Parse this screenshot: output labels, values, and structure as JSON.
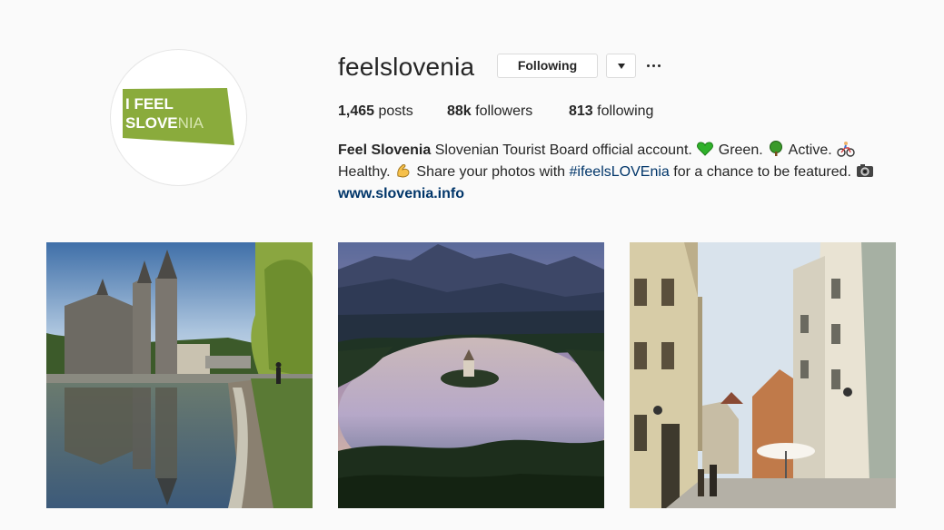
{
  "profile": {
    "username": "feelslovenia",
    "avatar_text_line1": "I FEEL",
    "avatar_text_line2_dark": "SLOVE",
    "avatar_text_line2_light": "NIA",
    "avatar_color": "#8aab3c"
  },
  "actions": {
    "following_label": "Following"
  },
  "stats": {
    "posts_count": "1,465",
    "posts_label": "posts",
    "followers_count": "88k",
    "followers_label": "followers",
    "following_count": "813",
    "following_label": "following"
  },
  "bio": {
    "name": "Feel Slovenia",
    "text1": " Slovenian Tourist Board official account. ",
    "text2": " Green. ",
    "text3": " Active. ",
    "text4": "Healthy. ",
    "text5": " Share your photos with ",
    "hashtag": "#ifeelsLOVEnia",
    "text6": " for a chance to be featured. ",
    "website": "www.slovenia.info"
  },
  "icons": [
    "green-heart-icon",
    "tree-icon",
    "cyclist-icon",
    "flexed-biceps-icon",
    "camera-icon",
    "dropdown-caret-icon",
    "more-options-icon"
  ],
  "posts": [
    {
      "subject": "church-reflection"
    },
    {
      "subject": "lake-bled"
    },
    {
      "subject": "old-town-street"
    }
  ]
}
